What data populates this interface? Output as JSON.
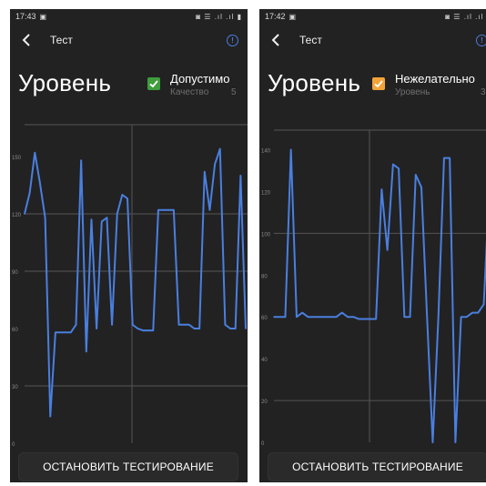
{
  "screens": [
    {
      "status_time": "17:43",
      "status_icons": "◙ ☰ .ıl .ıl ▮",
      "toolbar_title": "Тест",
      "big_title": "Уровень",
      "status_label": "Допустимо",
      "status_color": "#3e9d3c",
      "sub_label": "Качество",
      "sub_value": "5",
      "button_label": "ОСТАНОВИТЬ ТЕСТИРОВАНИЕ",
      "chart_data": {
        "type": "line",
        "series_color": "#4a7fe0",
        "ylim": [
          0,
          160
        ],
        "y_ticks": [
          "0",
          "30",
          "60",
          "90",
          "120",
          "150"
        ],
        "x": [
          0,
          1,
          2,
          3,
          4,
          5,
          6,
          7,
          8,
          9,
          10,
          11,
          12,
          13,
          14,
          15,
          16,
          17,
          18,
          19,
          20,
          21,
          22,
          23,
          24,
          25,
          26,
          27,
          28,
          29,
          30,
          31,
          32,
          33,
          34,
          35,
          36,
          37,
          38,
          39,
          40,
          41,
          42,
          43,
          44,
          45,
          46,
          47,
          48,
          49,
          50,
          51,
          52,
          53,
          54,
          55,
          56,
          57,
          58,
          59,
          60,
          61,
          62,
          63,
          64,
          65,
          66,
          67,
          68,
          69,
          70,
          71,
          72,
          73,
          74,
          75,
          76,
          77,
          78,
          79,
          80,
          81,
          82,
          83,
          84,
          85,
          86,
          87,
          88,
          89,
          90,
          91,
          92,
          93,
          94,
          95,
          96,
          97,
          98,
          99,
          100,
          101,
          102,
          103,
          104,
          105,
          106,
          107
        ],
        "values": [
          120,
          131,
          152,
          136,
          118,
          14,
          58,
          58,
          58,
          58,
          62,
          148,
          48,
          117,
          60,
          116,
          118,
          62,
          120,
          130,
          128,
          62,
          60,
          59,
          59,
          59,
          122,
          122,
          122,
          122,
          62,
          62,
          62,
          60,
          60,
          142,
          122,
          146,
          154,
          62,
          60,
          60,
          140,
          60
        ]
      }
    },
    {
      "status_time": "17:42",
      "status_icons": "◙ ☰ .ıl .ıl ▮",
      "toolbar_title": "Тест",
      "big_title": "Уровень",
      "status_label": "Нежелательно",
      "status_color": "#f2a43a",
      "sub_label": "Уровень",
      "sub_value": "3",
      "button_label": "ОСТАНОВИТЬ ТЕСТИРОВАНИЕ",
      "chart_data": {
        "type": "line",
        "series_color": "#4a7fe0",
        "ylim": [
          0,
          145
        ],
        "y_ticks": [
          "0",
          "20",
          "40",
          "60",
          "80",
          "100",
          "120",
          "140"
        ],
        "values": [
          60,
          60,
          60,
          140,
          60,
          62,
          60,
          60,
          60,
          60,
          60,
          60,
          62,
          60,
          60,
          59,
          59,
          59,
          59,
          121,
          92,
          133,
          131,
          60,
          60,
          128,
          122,
          60,
          0,
          60,
          136,
          136,
          0,
          60,
          60,
          62,
          62,
          66,
          122,
          125
        ]
      }
    }
  ]
}
